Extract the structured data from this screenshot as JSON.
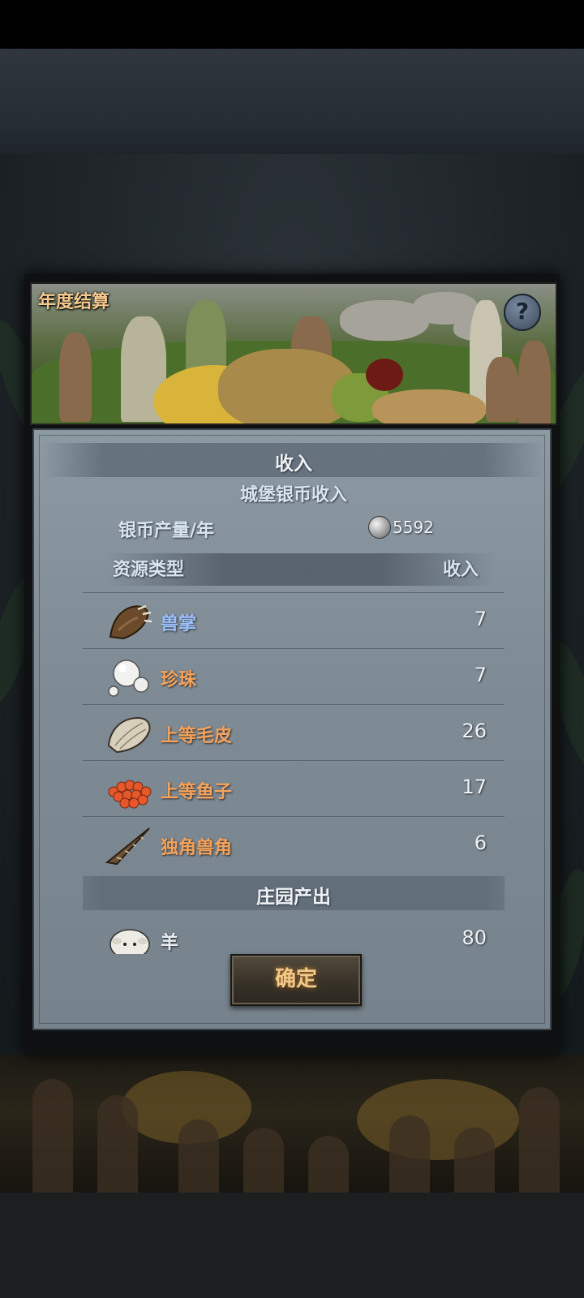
{
  "dialog": {
    "title": "年度结算",
    "help_label": "?",
    "income_header": "收入",
    "silver_section_title": "城堡银币收入",
    "silver_label": "银币产量/年",
    "silver_value": "5592",
    "columns": {
      "left": "资源类型",
      "right": "收入"
    },
    "manor_header": "庄园产出",
    "confirm_label": "确定"
  },
  "resources": [
    {
      "icon": "beast-paw-icon",
      "label": "兽掌",
      "value": "7",
      "color": "#9cc2ff"
    },
    {
      "icon": "pearl-icon",
      "label": "珍珠",
      "value": "7",
      "color": "#f5a35c"
    },
    {
      "icon": "fine-fur-icon",
      "label": "上等毛皮",
      "value": "26",
      "color": "#f5a35c"
    },
    {
      "icon": "fine-roe-icon",
      "label": "上等鱼子",
      "value": "17",
      "color": "#f5a35c"
    },
    {
      "icon": "unicorn-horn-icon",
      "label": "独角兽角",
      "value": "6",
      "color": "#f5a35c"
    }
  ],
  "manor": [
    {
      "icon": "sheep-icon",
      "label": "羊",
      "value": "80",
      "color": "#e8eef4"
    }
  ]
}
